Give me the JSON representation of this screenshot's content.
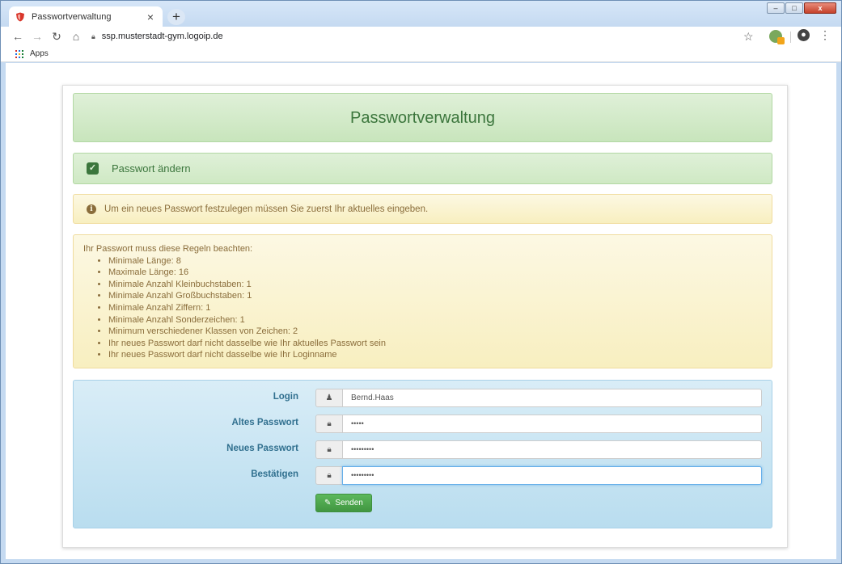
{
  "browser": {
    "tab_title": "Passwortverwaltung",
    "tab_close": "×",
    "new_tab": "+",
    "url": "ssp.musterstadt-gym.logoip.de",
    "bookmarks": {
      "apps_label": "Apps"
    },
    "window_controls": {
      "minimize": "–",
      "maximize": "□",
      "close": "x"
    }
  },
  "page": {
    "title": "Passwortverwaltung",
    "section_title": "Passwort ändern",
    "info_text": "Um ein neues Passwort festzulegen müssen Sie zuerst Ihr aktuelles eingeben.",
    "rules_intro": "Ihr Passwort muss diese Regeln beachten:",
    "rules": [
      "Minimale Länge: 8",
      "Maximale Länge: 16",
      "Minimale Anzahl Kleinbuchstaben: 1",
      "Minimale Anzahl Großbuchstaben: 1",
      "Minimale Anzahl Ziffern: 1",
      "Minimale Anzahl Sonderzeichen: 1",
      "Minimum verschiedener Klassen von Zeichen: 2",
      "Ihr neues Passwort darf nicht dasselbe wie Ihr aktuelles Passwort sein",
      "Ihr neues Passwort darf nicht dasselbe wie Ihr Loginname"
    ],
    "form": {
      "login_label": "Login",
      "login_value": "Bernd.Haas",
      "old_label": "Altes Passwort",
      "old_value": "•••••",
      "new_label": "Neues Passwort",
      "new_value": "•••••••••",
      "confirm_label": "Bestätigen",
      "confirm_value": "•••••••••",
      "submit_label": "Senden"
    }
  },
  "colors": {
    "success_text": "#3c763d",
    "warning_text": "#8a6d3b",
    "info_text": "#31708f",
    "button_green": "#5cb85c"
  }
}
